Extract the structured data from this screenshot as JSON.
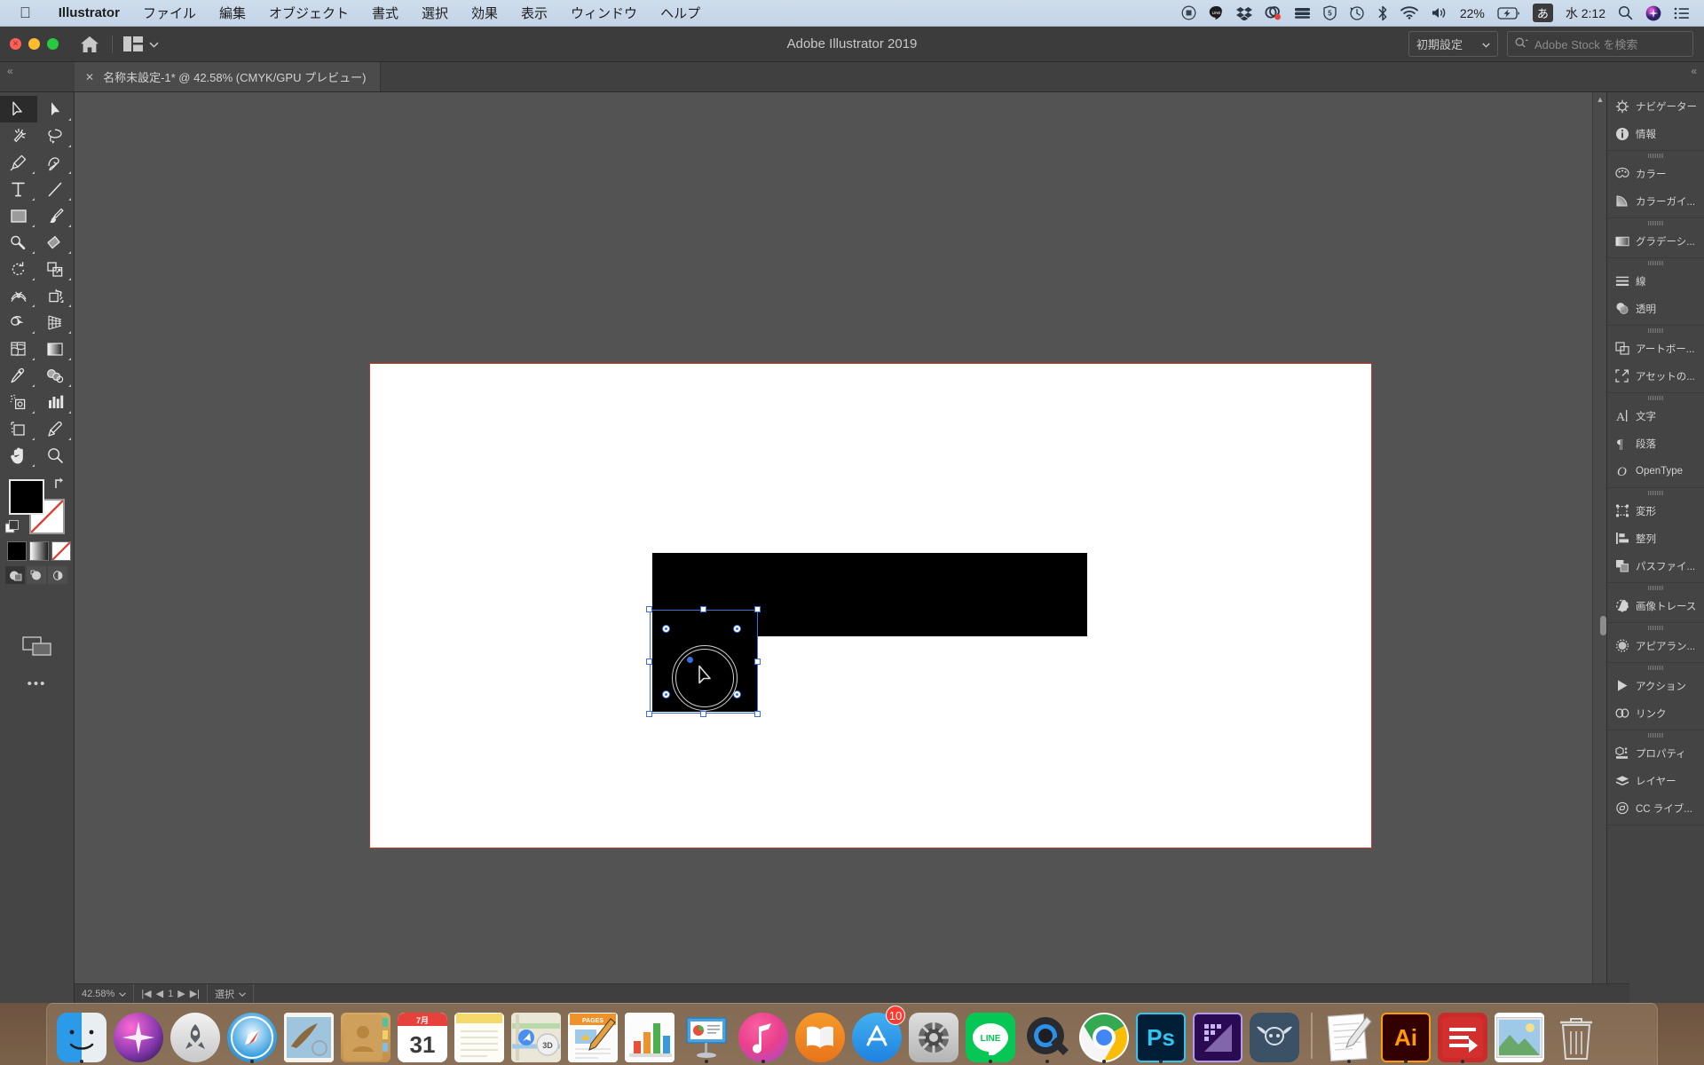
{
  "menubar": {
    "apple_icon": "apple-logo",
    "items": [
      "Illustrator",
      "ファイル",
      "編集",
      "オブジェクト",
      "書式",
      "選択",
      "効果",
      "表示",
      "ウィンドウ",
      "ヘルプ"
    ],
    "status": {
      "battery_percent": "22%",
      "ime": "あ",
      "clock": "水 2:12",
      "icons": [
        "screen-recording-icon",
        "line-icon",
        "dropbox-icon",
        "clipgrab-icon",
        "nas-icon",
        "sophos-icon",
        "timemachine-icon",
        "bluetooth-icon",
        "wifi-icon",
        "volume-icon",
        "battery-icon",
        "spotlight-icon",
        "siri-icon",
        "notification-center-icon"
      ]
    }
  },
  "app": {
    "title": "Adobe Illustrator 2019",
    "home_icon": "home-icon",
    "layout_icon": "arrange-documents-icon",
    "workspace": "初期設定",
    "stock_placeholder": "Adobe Stock を検索"
  },
  "tabbar": {
    "collapse_left": "«",
    "collapse_right": "«",
    "document_title": "名称未設定-1* @ 42.58% (CMYK/GPU プレビュー)",
    "close_glyph": "✕"
  },
  "toolbar": {
    "tools": [
      {
        "name": "selection-tool",
        "selected": true
      },
      {
        "name": "direct-selection-tool",
        "selected": false
      },
      {
        "name": "magic-wand-tool",
        "selected": false
      },
      {
        "name": "lasso-tool",
        "selected": false
      },
      {
        "name": "pen-tool",
        "selected": false
      },
      {
        "name": "curvature-tool",
        "selected": false
      },
      {
        "name": "type-tool",
        "selected": false
      },
      {
        "name": "line-segment-tool",
        "selected": false
      },
      {
        "name": "rectangle-tool",
        "selected": false
      },
      {
        "name": "paintbrush-tool",
        "selected": false
      },
      {
        "name": "shaper-tool",
        "selected": false
      },
      {
        "name": "eraser-tool",
        "selected": false
      },
      {
        "name": "rotate-tool",
        "selected": false
      },
      {
        "name": "scale-tool",
        "selected": false
      },
      {
        "name": "width-tool",
        "selected": false
      },
      {
        "name": "free-transform-tool",
        "selected": false
      },
      {
        "name": "shape-builder-tool",
        "selected": false
      },
      {
        "name": "perspective-grid-tool",
        "selected": false
      },
      {
        "name": "mesh-tool",
        "selected": false
      },
      {
        "name": "gradient-tool",
        "selected": false
      },
      {
        "name": "eyedropper-tool",
        "selected": false
      },
      {
        "name": "blend-tool",
        "selected": false
      },
      {
        "name": "symbol-sprayer-tool",
        "selected": false
      },
      {
        "name": "column-graph-tool",
        "selected": false
      },
      {
        "name": "artboard-tool",
        "selected": false
      },
      {
        "name": "slice-tool",
        "selected": false
      },
      {
        "name": "hand-tool",
        "selected": false
      },
      {
        "name": "zoom-tool",
        "selected": false
      }
    ],
    "fill_color": "#000000",
    "stroke_color": "#ffffff",
    "color_modes": [
      "color-swatch",
      "gradient-swatch",
      "none-swatch"
    ],
    "draw_modes": [
      "draw-normal",
      "draw-behind",
      "draw-inside"
    ],
    "screen_mode": "screen-mode-icon",
    "more_tools": "•••"
  },
  "canvas": {
    "artboard_bg": "#ffffff",
    "artboard_border": "#c0392b",
    "shapes": [
      {
        "name": "black-rectangle",
        "fill": "#000000"
      },
      {
        "name": "selected-black-square",
        "fill": "#000000"
      }
    ],
    "selection_color": "#3b6fe0"
  },
  "panels": {
    "groups": [
      {
        "items": [
          {
            "label": "ナビゲーター",
            "icon": "navigator-icon"
          },
          {
            "label": "情報",
            "icon": "info-icon"
          }
        ]
      },
      {
        "items": [
          {
            "label": "カラー",
            "icon": "color-icon"
          },
          {
            "label": "カラーガイ...",
            "icon": "color-guide-icon"
          }
        ]
      },
      {
        "items": [
          {
            "label": "グラデーシ...",
            "icon": "gradient-icon"
          }
        ]
      },
      {
        "items": [
          {
            "label": "線",
            "icon": "stroke-icon"
          },
          {
            "label": "透明",
            "icon": "transparency-icon"
          }
        ]
      },
      {
        "items": [
          {
            "label": "アートボー...",
            "icon": "artboards-icon"
          },
          {
            "label": "アセットの...",
            "icon": "asset-export-icon"
          }
        ]
      },
      {
        "items": [
          {
            "label": "文字",
            "icon": "character-icon"
          },
          {
            "label": "段落",
            "icon": "paragraph-icon"
          },
          {
            "label": "OpenType",
            "icon": "opentype-icon"
          }
        ]
      },
      {
        "items": [
          {
            "label": "変形",
            "icon": "transform-icon"
          },
          {
            "label": "整列",
            "icon": "align-icon"
          },
          {
            "label": "パスファイ...",
            "icon": "pathfinder-icon"
          }
        ]
      },
      {
        "items": [
          {
            "label": "画像トレース",
            "icon": "image-trace-icon"
          }
        ]
      },
      {
        "items": [
          {
            "label": "アピアラン...",
            "icon": "appearance-icon"
          }
        ]
      },
      {
        "items": [
          {
            "label": "アクション",
            "icon": "actions-icon"
          },
          {
            "label": "リンク",
            "icon": "links-icon"
          }
        ]
      },
      {
        "items": [
          {
            "label": "プロパティ",
            "icon": "properties-icon"
          },
          {
            "label": "レイヤー",
            "icon": "layers-icon"
          },
          {
            "label": "CC ライブ...",
            "icon": "cc-libraries-icon"
          }
        ]
      }
    ]
  },
  "statusbar": {
    "zoom": "42.58%",
    "nav_page": "1",
    "tool_status": "選択"
  },
  "dock": {
    "items": [
      {
        "name": "finder",
        "label": "Finder",
        "running": true
      },
      {
        "name": "siri",
        "label": "Siri",
        "running": false
      },
      {
        "name": "launchpad",
        "label": "Launchpad",
        "running": false
      },
      {
        "name": "safari",
        "label": "Safari",
        "running": true
      },
      {
        "name": "mail",
        "label": "Mail",
        "running": false
      },
      {
        "name": "contacts",
        "label": "Contacts",
        "running": false
      },
      {
        "name": "calendar",
        "label": "Calendar",
        "running": false,
        "month": "7月",
        "day": "31"
      },
      {
        "name": "notes",
        "label": "Notes",
        "running": false
      },
      {
        "name": "maps",
        "label": "Maps",
        "running": false
      },
      {
        "name": "pages",
        "label": "Pages",
        "running": false
      },
      {
        "name": "numbers",
        "label": "Numbers",
        "running": false
      },
      {
        "name": "keynote",
        "label": "Keynote",
        "running": false
      },
      {
        "name": "itunes",
        "label": "iTunes",
        "running": true
      },
      {
        "name": "ibooks",
        "label": "iBooks",
        "running": false
      },
      {
        "name": "appstore",
        "label": "App Store",
        "running": false,
        "badge": "10"
      },
      {
        "name": "system-preferences",
        "label": "システム環境設定",
        "running": false
      },
      {
        "name": "line",
        "label": "LINE",
        "running": true
      },
      {
        "name": "quicktime",
        "label": "QuickTime Player",
        "running": true
      },
      {
        "name": "chrome",
        "label": "Google Chrome",
        "running": true
      },
      {
        "name": "photoshop",
        "label": "Ps",
        "running": true
      },
      {
        "name": "aftereffects",
        "label": "Ae",
        "running": false
      },
      {
        "name": "handbrake",
        "label": "HandBrake",
        "running": false
      },
      {
        "name": "textedit",
        "label": "TextEdit",
        "running": true
      },
      {
        "name": "illustrator",
        "label": "Ai",
        "running": true
      },
      {
        "name": "filezilla",
        "label": "FileZilla",
        "running": true
      },
      {
        "name": "photos-folder",
        "label": "Pictures",
        "running": false
      },
      {
        "name": "trash",
        "label": "ゴミ箱",
        "running": false
      }
    ]
  }
}
